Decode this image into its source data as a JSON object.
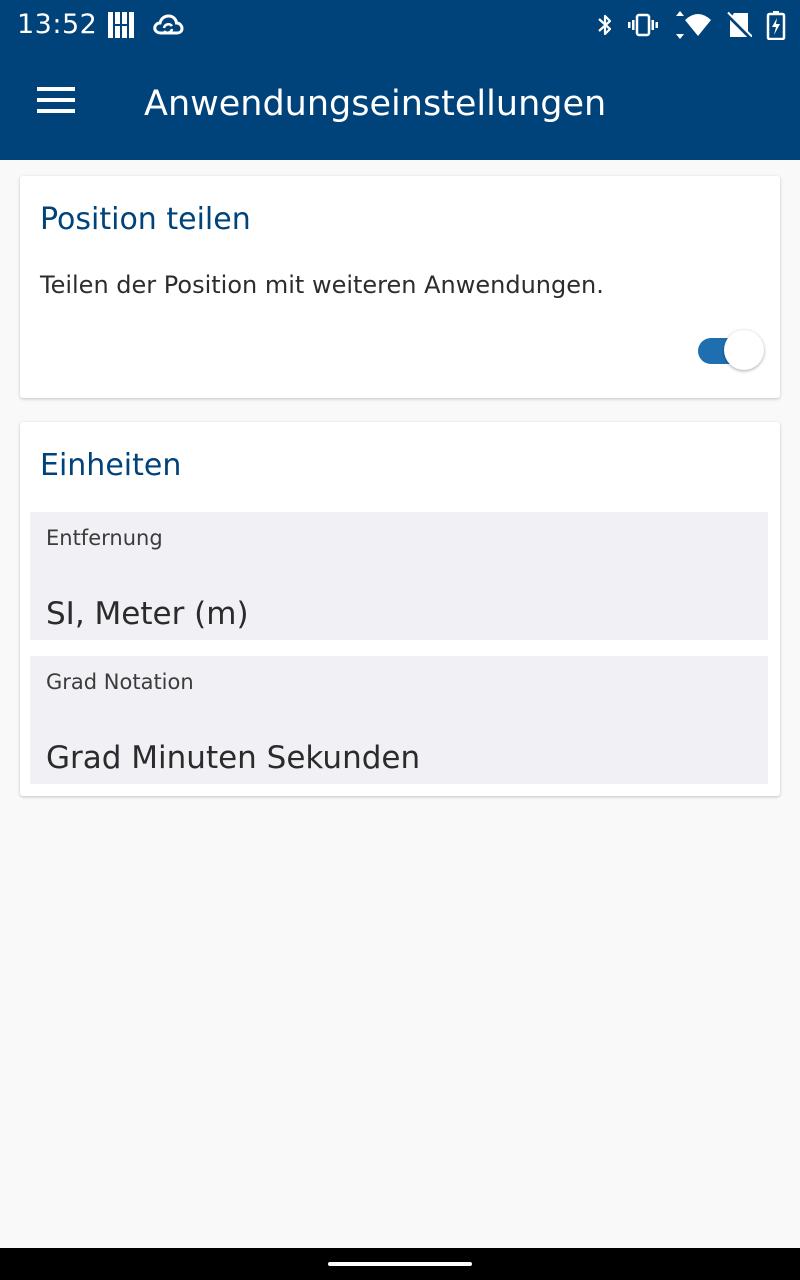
{
  "status_bar": {
    "time": "13:52",
    "left_icons": [
      "grid-app-icon",
      "cloud-sync-icon"
    ],
    "right_icons": [
      "bluetooth-icon",
      "vibrate-icon",
      "wifi-icon",
      "no-sim-icon",
      "battery-charging-icon"
    ]
  },
  "toolbar": {
    "title": "Anwendungseinstellungen",
    "menu_icon": "menu-icon"
  },
  "location_card": {
    "title": "Position teilen",
    "description": "Teilen der Position mit weiteren Anwendungen.",
    "toggle_on": true
  },
  "units_card": {
    "title": "Einheiten",
    "fields": [
      {
        "label": "Entfernung",
        "value": "SI, Meter (m)"
      },
      {
        "label": "Grad Notation",
        "value": "Grad Minuten Sekunden"
      }
    ]
  },
  "colors": {
    "primary": "#00427a",
    "toggle_accent": "#1f6fb0",
    "background": "#f9f9f9",
    "field_background": "#f0f0f5"
  }
}
